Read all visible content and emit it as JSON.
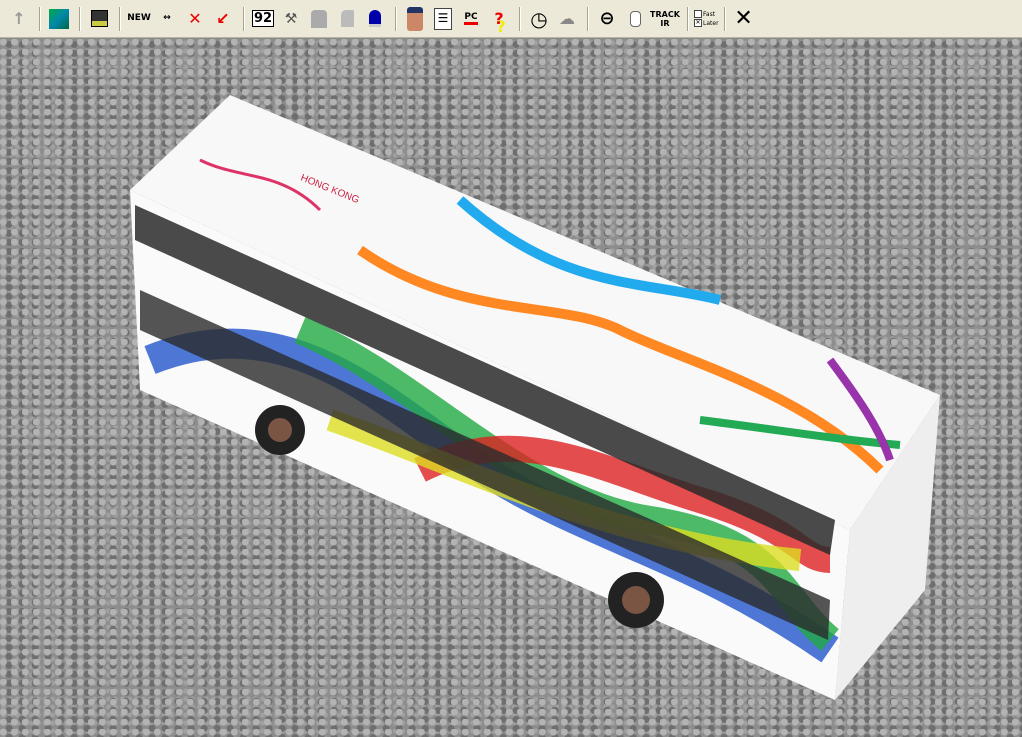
{
  "toolbar": {
    "buttons": [
      {
        "icon": "up-arrow-icon",
        "glyph": "↑"
      },
      {
        "icon": "map-icon",
        "glyph": ""
      },
      {
        "icon": "save-icon",
        "glyph": "💾"
      },
      {
        "icon": "new-vehicle-icon",
        "label": "NEW"
      },
      {
        "icon": "move-vehicle-icon",
        "label": "↔"
      },
      {
        "icon": "delete-vehicle-icon",
        "glyph": "✕"
      },
      {
        "icon": "pointer-arrow-icon",
        "glyph": "↙"
      },
      {
        "icon": "number-edit-icon",
        "label": "92"
      },
      {
        "icon": "wrench-icon",
        "glyph": "🔧"
      },
      {
        "icon": "chip-icon",
        "glyph": ""
      },
      {
        "icon": "fuel-icon",
        "glyph": ""
      },
      {
        "icon": "bell-icon",
        "glyph": ""
      },
      {
        "icon": "driver-icon",
        "glyph": ""
      },
      {
        "icon": "document-icon",
        "glyph": "☰"
      },
      {
        "icon": "pc-swap-icon",
        "label": "PC"
      },
      {
        "icon": "help-arrow-icon",
        "label": "?"
      },
      {
        "icon": "clock-icon",
        "glyph": "◷"
      },
      {
        "icon": "weather-icon",
        "glyph": "☁"
      },
      {
        "icon": "steering-wheel-icon",
        "glyph": "⊖"
      },
      {
        "icon": "mouse-icon",
        "glyph": "🖱"
      },
      {
        "icon": "trackir-icon",
        "label": "TRACK IR"
      }
    ],
    "checkboxes": [
      {
        "label": "Fast",
        "checked": false
      },
      {
        "label": "Later",
        "checked": true
      }
    ],
    "close": {
      "glyph": "✕"
    }
  },
  "scene": {
    "bus_logo_text": "HONG KONG",
    "colors": {
      "toolbar": "#ece9d8",
      "bus_body": "#ffffff",
      "ground": "#8d8d8d"
    }
  }
}
